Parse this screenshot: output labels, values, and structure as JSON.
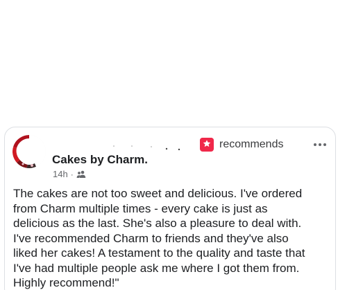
{
  "post": {
    "recommendation_label": "recommends",
    "page_name": "Cakes by Charm.",
    "time": "14h",
    "separator": "·",
    "audience_icon": "friends-icon",
    "more_icon": "more-options-icon",
    "body_lines": [
      "The cakes are not too sweet and delicious. I've ordered",
      "from Charm multiple times - every cake is just as",
      "delicious as the last. She's also a pleasure to deal with.",
      "I've recommended Charm to friends and they've also",
      "liked her cakes! A testament to the quality and taste that",
      "I've had multiple people ask me where I got them from.",
      "Highly recommend!\""
    ]
  },
  "colors": {
    "recommend_badge": "#f0284a",
    "text": "#1c1e21",
    "secondary_text": "#65676b"
  }
}
